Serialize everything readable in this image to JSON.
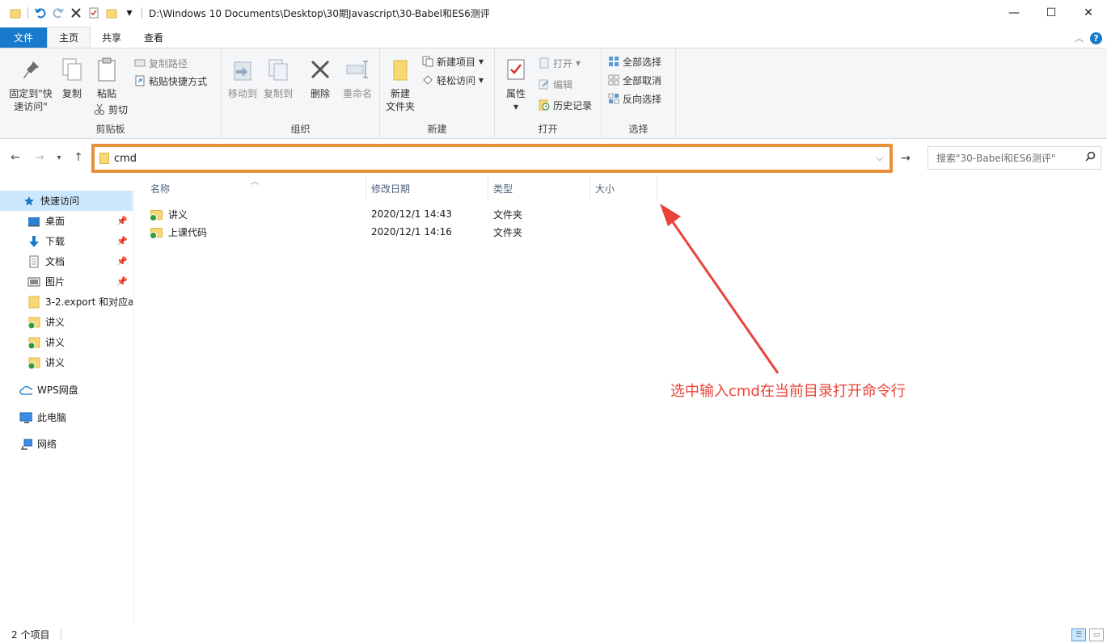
{
  "titlebar": {
    "path": "D:\\Windows 10 Documents\\Desktop\\30期Javascript\\30-Babel和ES6测评",
    "qat_dropdown": "▾"
  },
  "window_controls": {
    "minimize": "—",
    "maximize": "☐",
    "close": "✕"
  },
  "tabs": [
    {
      "label": "文件"
    },
    {
      "label": "主页"
    },
    {
      "label": "共享"
    },
    {
      "label": "查看"
    }
  ],
  "ribbon": {
    "clipboard": {
      "label": "剪贴板",
      "pin_line1": "固定到\"快",
      "pin_line2": "速访问\"",
      "copy": "复制",
      "paste": "粘贴",
      "copy_path": "复制路径",
      "paste_shortcut": "粘贴快捷方式",
      "cut": "剪切"
    },
    "organize": {
      "label": "组织",
      "move_to": "移动到",
      "copy_to": "复制到",
      "delete": "删除",
      "rename": "重命名"
    },
    "new": {
      "label": "新建",
      "new_folder_line1": "新建",
      "new_folder_line2": "文件夹",
      "new_item": "新建项目",
      "easy_access": "轻松访问"
    },
    "open": {
      "label": "打开",
      "properties": "属性",
      "open": "打开",
      "edit": "编辑",
      "history": "历史记录"
    },
    "select": {
      "label": "选择",
      "select_all": "全部选择",
      "select_none": "全部取消",
      "invert": "反向选择"
    }
  },
  "address": {
    "value": "cmd",
    "search_placeholder": "搜索\"30-Babel和ES6测评\""
  },
  "nav": {
    "quick_access": "快速访问",
    "items": [
      {
        "label": "桌面",
        "pinned": true
      },
      {
        "label": "下载",
        "pinned": true
      },
      {
        "label": "文档",
        "pinned": true
      },
      {
        "label": "图片",
        "pinned": true
      },
      {
        "label": "3-2.export 和对应a"
      },
      {
        "label": "讲义"
      },
      {
        "label": "讲义"
      },
      {
        "label": "讲义"
      }
    ],
    "wps": "WPS网盘",
    "this_pc": "此电脑",
    "network": "网络"
  },
  "columns": {
    "name": "名称",
    "modified": "修改日期",
    "type": "类型",
    "size": "大小"
  },
  "files": [
    {
      "name": "讲义",
      "modified": "2020/12/1 14:43",
      "type": "文件夹"
    },
    {
      "name": "上课代码",
      "modified": "2020/12/1 14:16",
      "type": "文件夹"
    }
  ],
  "annotation": "选中输入cmd在当前目录打开命令行",
  "status": {
    "count": "2 个项目"
  },
  "colors": {
    "accent": "#1979ca",
    "highlight_border": "#e8903a",
    "annotation": "#e8443a",
    "selected_bg": "#cce8ff"
  }
}
